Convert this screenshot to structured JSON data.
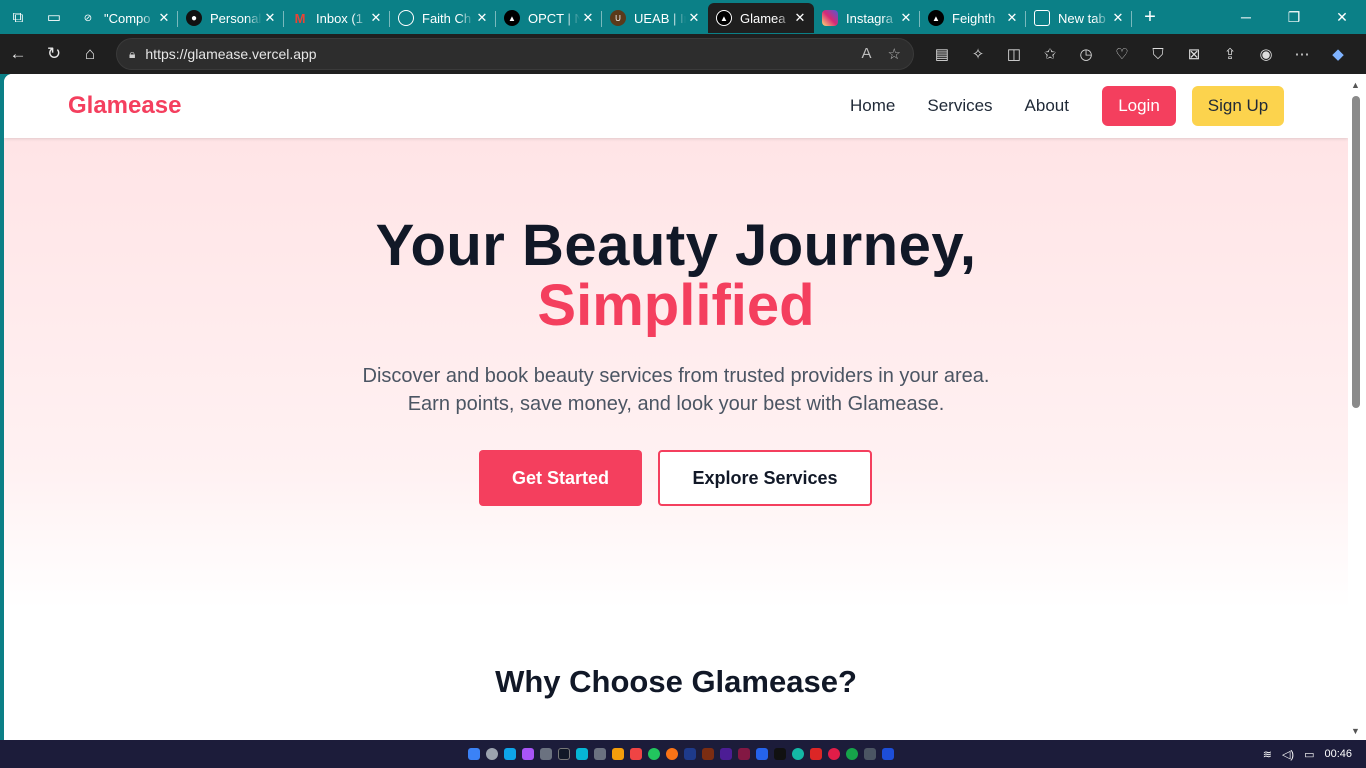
{
  "browser": {
    "tabs": [
      {
        "title": "\"Compo",
        "favicon": "o",
        "fav_color": "#0b8087"
      },
      {
        "title": "Personal",
        "favicon": "gh",
        "fav_color": "#111111"
      },
      {
        "title": "Inbox (1",
        "favicon": "M",
        "fav_color": "#ea4335"
      },
      {
        "title": "Faith Ch",
        "favicon": "globe",
        "fav_color": "#0b8087"
      },
      {
        "title": "OPCT | N",
        "favicon": "▲",
        "fav_color": "#000000"
      },
      {
        "title": "UEAB | Ir",
        "favicon": "U",
        "fav_color": "#5b3a1a"
      },
      {
        "title": "Glamea",
        "favicon": "▲",
        "fav_color": "#000000"
      },
      {
        "title": "Instagra",
        "favicon": "ig",
        "fav_color": "#d6249f"
      },
      {
        "title": "Feighth",
        "favicon": "▲",
        "fav_color": "#000000"
      },
      {
        "title": "New tab",
        "favicon": "nt",
        "fav_color": "#0b8087"
      }
    ],
    "active_tab_index": 6,
    "url": "https://glamease.vercel.app"
  },
  "site": {
    "brand": "Glamease",
    "nav": {
      "home": "Home",
      "services": "Services",
      "about": "About",
      "login": "Login",
      "signup": "Sign Up"
    },
    "hero": {
      "title_line1": "Your Beauty Journey,",
      "title_line2": "Simplified",
      "subtitle": "Discover and book beauty services from trusted providers in your area. Earn points, save money, and look your best with Glamease.",
      "cta_primary": "Get Started",
      "cta_secondary": "Explore Services"
    },
    "section_title": "Why Choose Glamease?"
  },
  "taskbar": {
    "time": "00:46"
  },
  "colors": {
    "accent": "#f43f5e",
    "signup": "#fcd34d",
    "tabbar": "#0b8087"
  }
}
